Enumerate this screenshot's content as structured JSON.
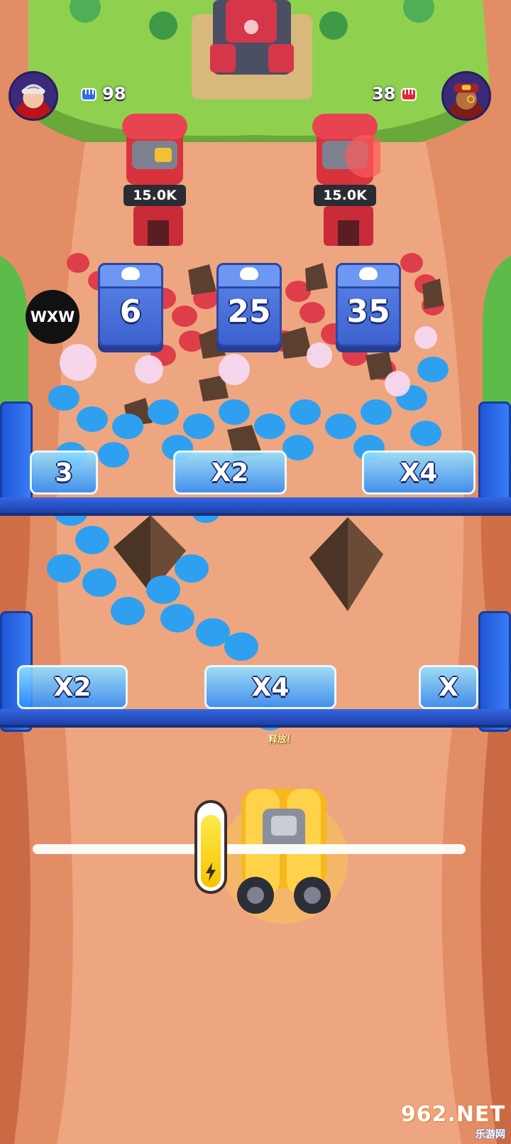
{
  "hud": {
    "player": {
      "power": "98",
      "avatar_icon": "player-avatar-icon",
      "power_icon": "blue-fist-icon",
      "color": "#2f6ee8"
    },
    "enemy": {
      "power": "38",
      "avatar_icon": "enemy-avatar-icon",
      "power_icon": "red-fist-icon",
      "color": "#e0263a"
    }
  },
  "towers": [
    {
      "hp": "15.0K"
    },
    {
      "hp": "15.0K"
    }
  ],
  "spawn_boxes": [
    {
      "count": "6"
    },
    {
      "count": "25"
    },
    {
      "count": "35"
    }
  ],
  "player_badge": {
    "name": "WXW"
  },
  "gates_upper": [
    {
      "label": "3"
    },
    {
      "label": "X2"
    },
    {
      "label": "X4"
    }
  ],
  "gates_lower": [
    {
      "label": "X2"
    },
    {
      "label": "X4"
    },
    {
      "label": "X"
    }
  ],
  "cannon": {
    "release_label": "释放！",
    "power_level": 0.9
  },
  "watermark": {
    "main": "962.NET",
    "sub": "乐游网"
  }
}
